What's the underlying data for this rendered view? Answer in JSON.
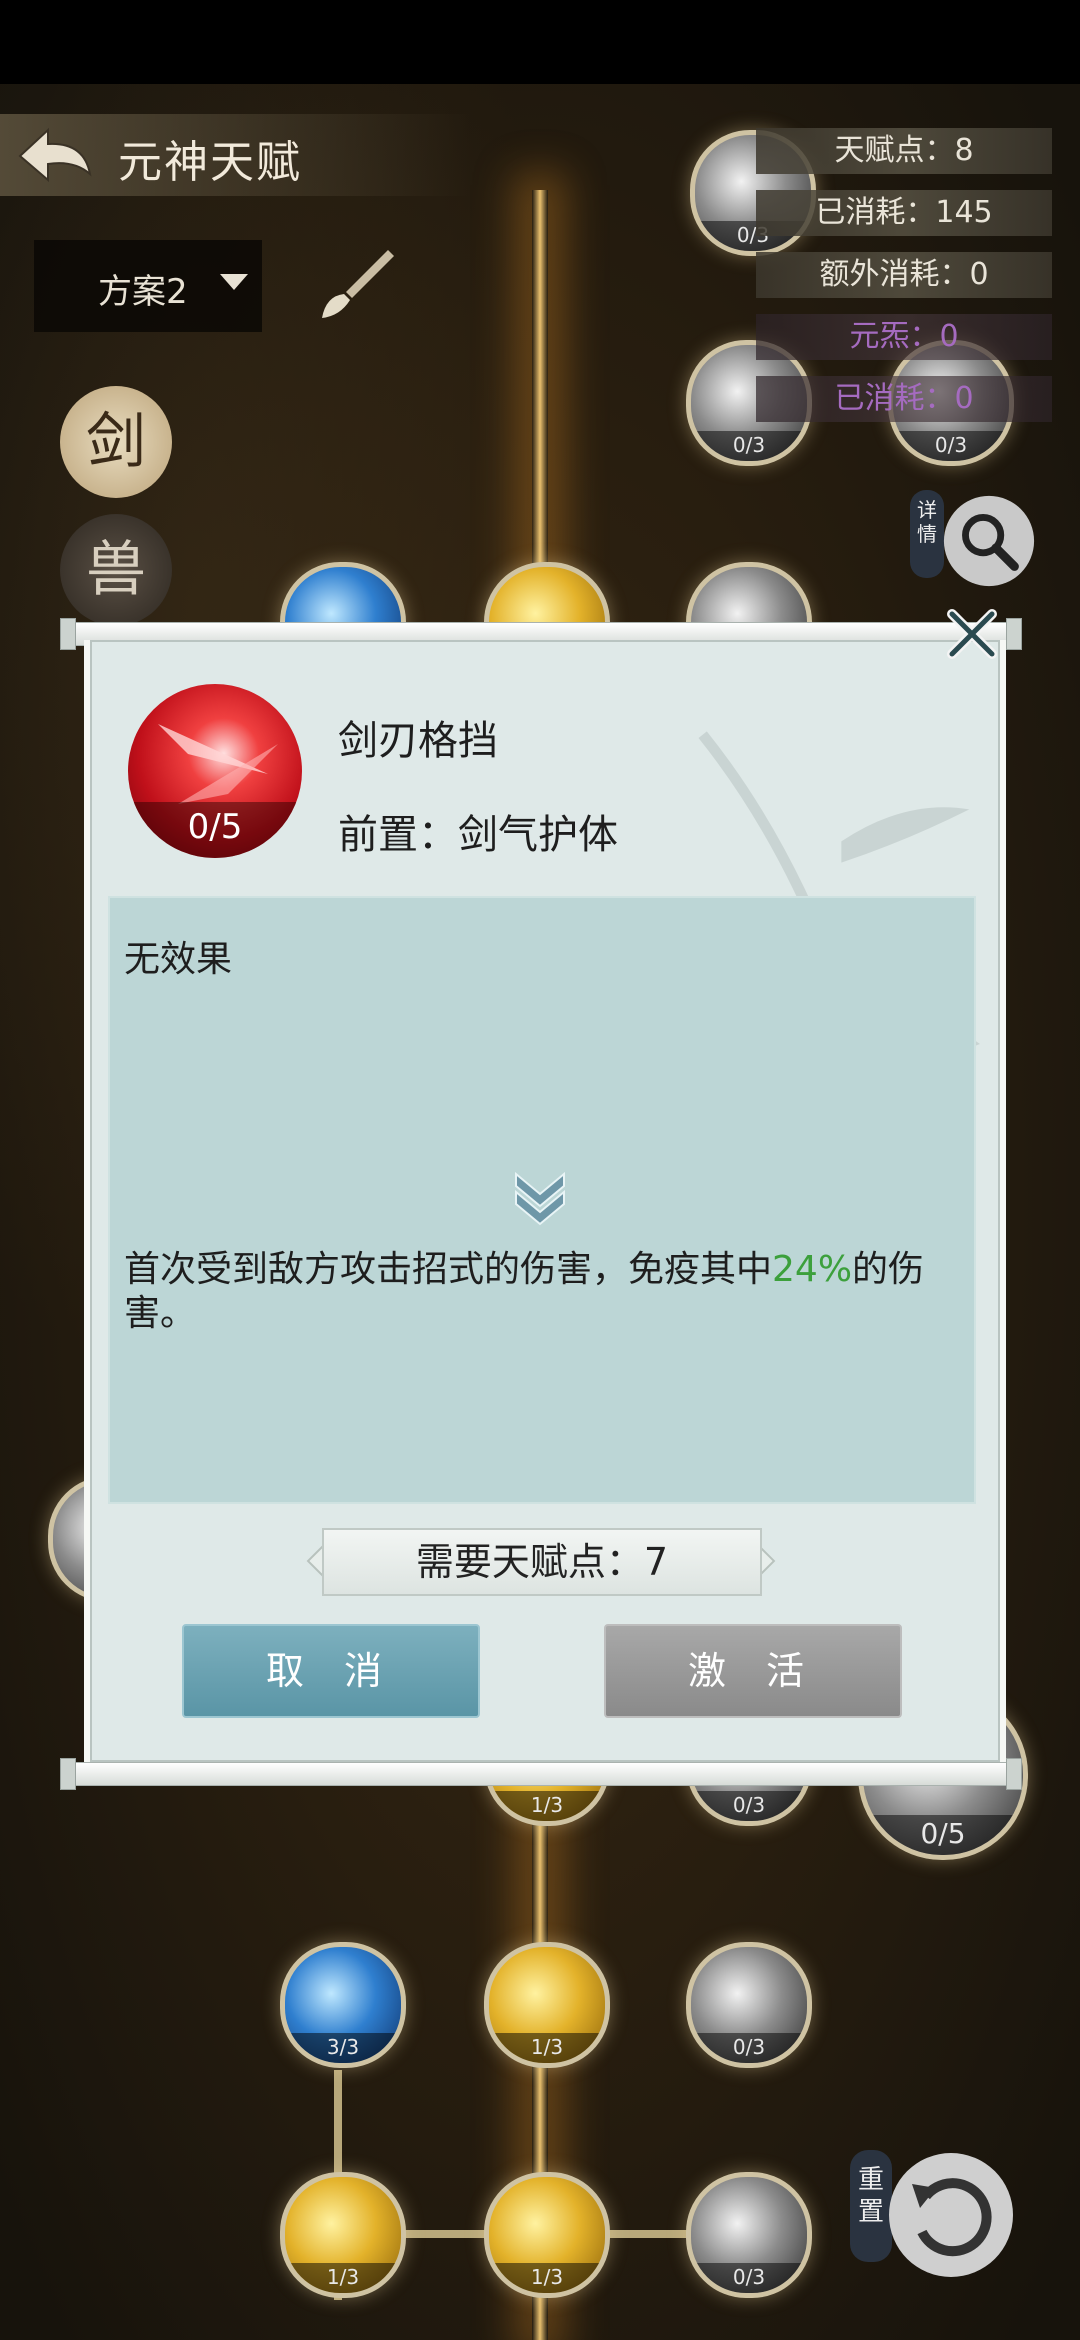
{
  "header": {
    "title": "元神天赋"
  },
  "plan": {
    "label": "方案2"
  },
  "stats": {
    "talent_points": "天赋点：8",
    "consumed": "已消耗：145",
    "extra_consumed": "额外消耗：0",
    "yuan_xi": "元炁：0",
    "consumed2": "已消耗：0"
  },
  "side_tabs": {
    "sword": "剑",
    "second": "兽"
  },
  "buttons": {
    "detail": "详情",
    "reset": "重置"
  },
  "dialog": {
    "skill_name": "剑刃格挡",
    "skill_level": "0/5",
    "prerequisite": "前置：剑气护体",
    "current_effect": "无效果",
    "next_effect_before": "首次受到敌方攻击招式的伤害，免疫其中",
    "next_effect_value": "24%",
    "next_effect_after": "的伤害。",
    "cost": "需要天赋点：7",
    "cancel": "取 消",
    "activate": "激 活"
  },
  "nodes": [
    {
      "label": "0/3"
    },
    {
      "label": "0/3"
    },
    {
      "label": "0/3"
    },
    {
      "label": "1/3"
    },
    {
      "label": "0/3"
    },
    {
      "label": "0/5"
    },
    {
      "label": "3/3"
    },
    {
      "label": "1/3"
    },
    {
      "label": "0/3"
    },
    {
      "label": "1/3"
    },
    {
      "label": "1/3"
    },
    {
      "label": "0/3"
    }
  ],
  "colors": {
    "accent_green": "#3ca03c",
    "cancel_button": "#6aa3b3",
    "activate_button": "#999999",
    "purple_stat": "#a56bc0"
  },
  "icons": [
    "back-arrow-icon",
    "dropdown-caret-icon",
    "brush-icon",
    "search-icon",
    "close-icon",
    "double-chevron-down-icon",
    "reset-icon"
  ]
}
